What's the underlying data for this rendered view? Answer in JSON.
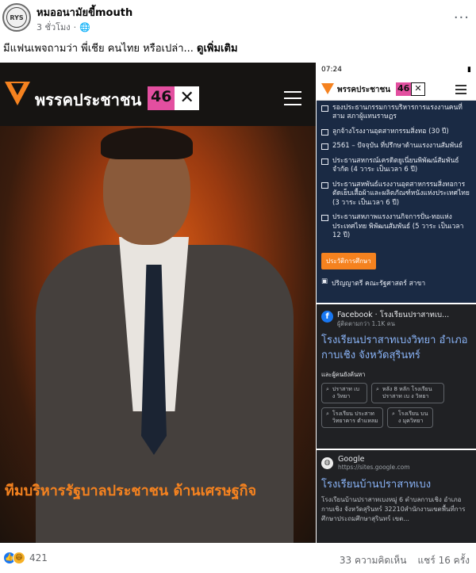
{
  "post": {
    "page_name": "หมออนามัยขี้mouth",
    "avatar_text": "RYS",
    "time": "3 ชั่วโมง",
    "privacy_icon": "globe-icon",
    "more": "···",
    "caption": "มีแฟนเพจถามว่า พี่เชีย คนไทย หรือเปล่า...",
    "see_more": "ดูเพิ่มเติม"
  },
  "left_image": {
    "party_name": "พรรคประชาชน",
    "party_number": "46",
    "party_mark": "✕",
    "caption": "ทีมบริหารรัฐบาลประชาชน ด้านเศรษฐกิจ"
  },
  "right_top": {
    "status_time": "07:24",
    "party_name": "พรรคประชาชน",
    "party_number": "46",
    "party_mark": "✕",
    "cv_items": [
      "รองประธานกรรมการบริหารการแรงงานคนที่สาม สภาผู้แทนราษฎร",
      "ลูกจ้างโรงงานอุตสาหกรรมสิ่งทอ (30 ปี)",
      "2561 – ปัจจุบัน ที่ปรึกษาด้านแรงงานสัมพันธ์",
      "ประธานสหกรณ์เครดิตยูเนี่ยนพิพัฒน์สัมพันธ์ จำกัด (4 วาระ เป็นเวลา 6 ปี)",
      "ประธานสหพันธ์แรงงานอุตสาหกรรมสิ่งทอการตัดเย็บเสื้อผ้าและผลิตภัณฑ์หนังแห่งประเทศไทย (3 วาระ เป็นเวลา 6 ปี)",
      "ประธานสหภาพแรงงานกิจการปั่น-ทอแห่งประเทศไทย พิพัฒนสัมพันธ์ (5 วาระ เป็นเวลา 12 ปี)"
    ],
    "education_button": "ประวัติการศึกษา",
    "education_line": "ปริญญาตรี คณะรัฐศาสตร์ สาขา"
  },
  "right_mid": {
    "source_name": "Facebook · โรงเรียนปราสาทเบ...",
    "source_followers": "ผู้ติดตามกว่า 1.1K คน",
    "result_title": "โรงเรียนปราสาทเบงวิทยา อำเภอกาบเชิง จังหวัดสุรินทร์",
    "people_also_search": "และผู้คนยังค้นหา",
    "chips": [
      "ปราสาท เบ ง วิทยา",
      "หลัง 8 หลัก โรงเรียน ปราสาท เบ ง วิทยา",
      "โรงเรียน ประสาท วิทยาคาร ตำแหลม",
      "โรงเรียน บน ง มุควิทยา"
    ]
  },
  "right_bot": {
    "source_name": "Google",
    "source_url": "https://sites.google.com",
    "result_title": "โรงเรียนบ้านปราสาทเบง",
    "snippet": "โรงเรียนบ้านปราสาทเบงหมู่ 6 ตำบลกาบเชิง อำเภอกาบเชิง จังหวัดสุรินทร์ 32210สำนักงานเขตพื้นที่การศึกษาประถมศึกษาสุรินทร์ เขต..."
  },
  "footer": {
    "reaction_count": "421",
    "comments": "33 ความคิดเห็น",
    "shares": "แชร์ 16 ครั้ง"
  }
}
